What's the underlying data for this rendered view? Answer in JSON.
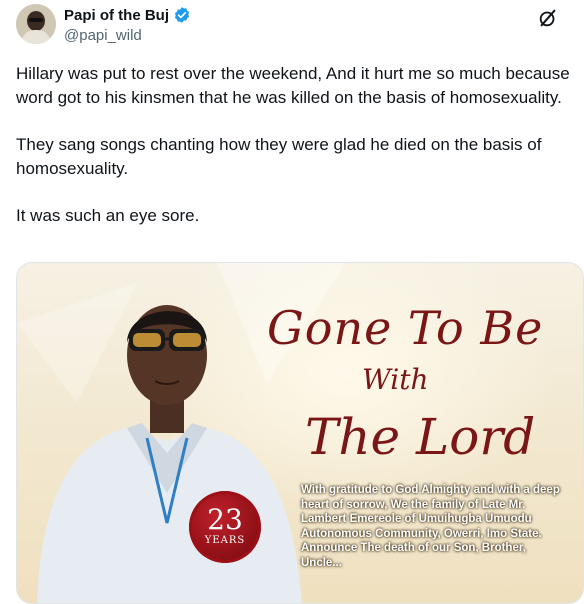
{
  "author": {
    "display_name": "Papi of the Buj",
    "handle": "@papi_wild",
    "verified_icon": "verified-badge-icon",
    "verified_color": "#1d9bf0"
  },
  "more_icon": "grok-slash-icon",
  "tweet": {
    "paragraphs": [
      "Hillary was put to rest over the weekend, And it hurt me so much because word got to his kinsmen that he was killed on the basis of homosexuality.",
      "They sang songs chanting how they were glad he died on the basis of homosexuality.",
      "It was such an eye sore."
    ]
  },
  "media": {
    "heading_line1": "Gone To Be",
    "heading_line2": "With",
    "heading_line3": "The Lord",
    "notice": "With gratitude to God Almighty and with a deep heart of sorrow, We the family of Late Mr. Lambert Emereole of Umuihugba Umuodu Autonomous Community, Owerri, Imo State. Announce The death of our Son, Brother, Uncle...",
    "seal_number": "23",
    "seal_label": "YEARS",
    "heading_color": "#7a1616"
  }
}
